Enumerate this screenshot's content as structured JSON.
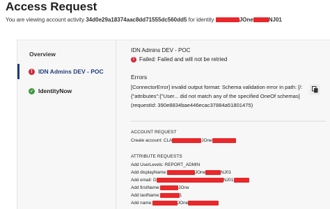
{
  "header": {
    "title": "Access Request",
    "subtitle_prefix": "You are viewing account activity",
    "activity_id": "34d0e29a18374aac8dd71555dc560dd5",
    "subtitle_mid": "for identity",
    "identity_fragment": "JOne",
    "identity_suffix": "NJ01"
  },
  "sidebar": {
    "items": [
      {
        "label": "Overview",
        "icon": ""
      },
      {
        "label": "IDN Admins DEV - POC",
        "icon": "error-icon"
      },
      {
        "label": "IdentityNow",
        "icon": "check-circle-icon"
      }
    ]
  },
  "main": {
    "section_title": "IDN Admins DEV - POC",
    "status_text": "Failed: Failed and will not be retried",
    "errors_label": "Errors",
    "error_message": "[ConnectorError] invalid output format: Schema validation error in path: [/: {\"attributes\":{\"User... did not match any of the specified OneOf schemas] (requestId: 390e8834bae446ecac37884a51801475)",
    "account_request_label": "ACCOUNT REQUEST",
    "create_account_prefix": "Create account: CLA",
    "create_account_fragment": "JOne",
    "attribute_requests_label": "ATTRIBUTE REQUESTS",
    "attr_userlevels": "Add UserLevels: REPORT_ADMIN",
    "attr_displayname_prefix": "Add displayName:",
    "attr_displayname_mid": "JOne",
    "attr_displayname_suffix": "NJ01",
    "attr_email_prefix": "Add email: D",
    "attr_email_suffix": "NJ01",
    "attr_firstname_prefix": "Add firstName:",
    "attr_firstname_suffix": "JOne",
    "attr_lastname_prefix": "Add lastName:",
    "attr_lastname_suffix": "1",
    "attr_name_prefix": "Add name:",
    "attr_name_mid": "JOne"
  },
  "colors": {
    "redaction": "#e8282b",
    "active_accent": "#1d3c78",
    "error": "#cf2a3b",
    "success": "#3c9a3e"
  }
}
